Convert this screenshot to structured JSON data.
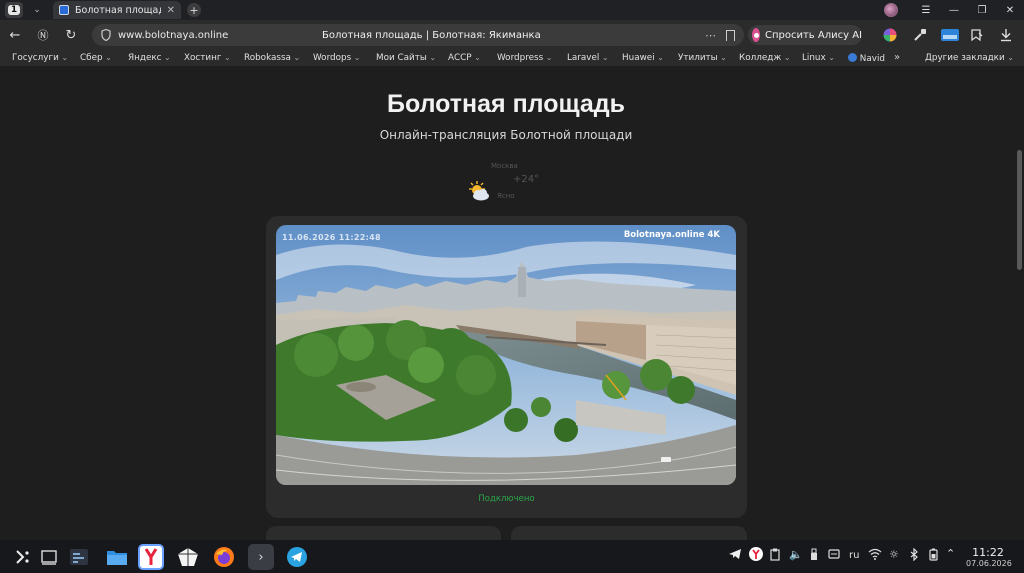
{
  "browser": {
    "tab_count": "1",
    "tab_title": "Болотная площадь | Бол",
    "url": "www.bolotnaya.online",
    "page_title": "Болотная площадь | Болотная: Якиманка",
    "alice_label": "Спросить Алису AI"
  },
  "bookmarks": {
    "items": [
      "Госуслуги",
      "Сбер",
      "Яндекс",
      "Хостинг",
      "Robokassa",
      "Wordops",
      "Мои Сайты",
      "АССР",
      "Wordpress",
      "Laravel",
      "Huawei",
      "Утилиты",
      "Колледж",
      "Linux",
      "Navid"
    ],
    "other": "Другие закладки"
  },
  "page": {
    "heading": "Болотная площадь",
    "subtitle": "Онлайн-трансляция Болотной площади",
    "weather": {
      "city": "Москва",
      "temp": "+24°",
      "condition": "Ясно",
      "icon": "sun-cloud-icon"
    },
    "stream": {
      "timestamp": "11.06.2026 11:22:48",
      "brand": "Bolotnaya.online 4K",
      "status": "Подключено",
      "status_color": "#2aa74a"
    }
  },
  "taskbar": {
    "lang": "ru",
    "time": "11:22",
    "date": "07.06.2026"
  },
  "colors": {
    "background": "#1e1e1e",
    "card": "#2c2c2c",
    "accent": "#d9508e"
  }
}
